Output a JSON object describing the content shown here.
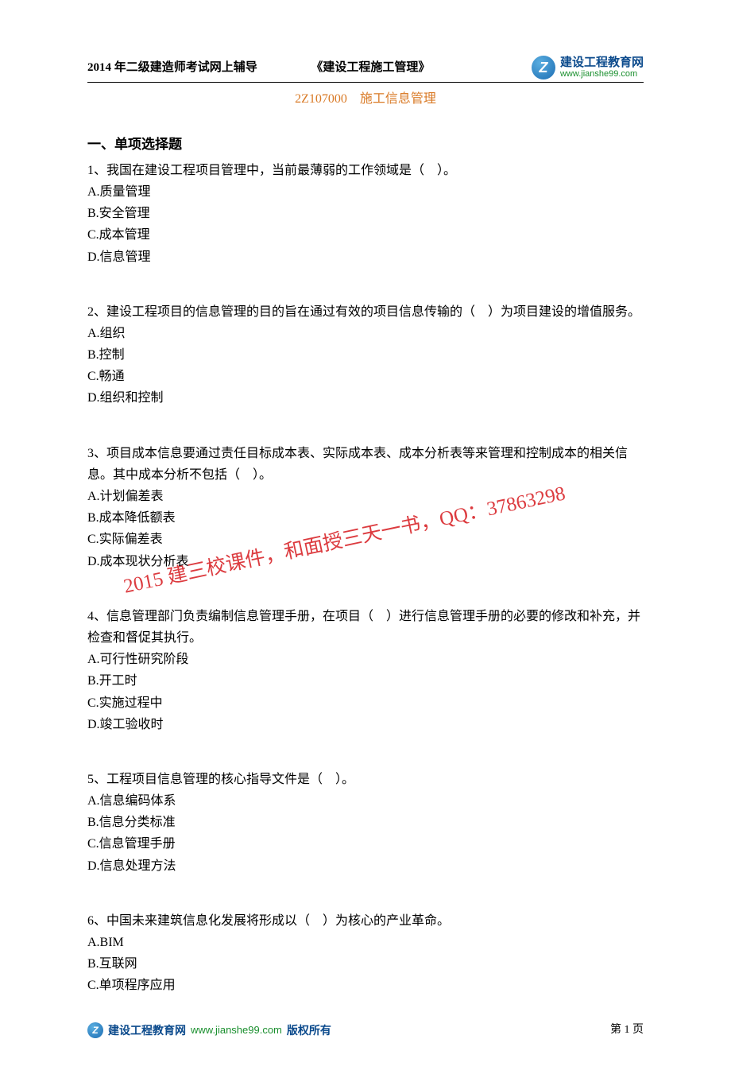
{
  "header": {
    "left": "2014 年二级建造师考试网上辅导",
    "center": "《建设工程施工管理》",
    "logo_letter": "Z",
    "logo_cn": "建设工程教育网",
    "logo_en": "www.jianshe99.com"
  },
  "subtitle": "2Z107000　施工信息管理",
  "section_title": "一、单项选择题",
  "questions": [
    {
      "text": "1、我国在建设工程项目管理中，当前最薄弱的工作领域是（　）。",
      "options": [
        "A.质量管理",
        "B.安全管理",
        "C.成本管理",
        "D.信息管理"
      ]
    },
    {
      "text": "2、建设工程项目的信息管理的目的旨在通过有效的项目信息传输的（　）为项目建设的增值服务。",
      "options": [
        "A.组织",
        "B.控制",
        "C.畅通",
        "D.组织和控制"
      ]
    },
    {
      "text": "3、项目成本信息要通过责任目标成本表、实际成本表、成本分析表等来管理和控制成本的相关信息。其中成本分析不包括（　）。",
      "options": [
        "A.计划偏差表",
        "B.成本降低额表",
        "C.实际偏差表",
        "D.成本现状分析表"
      ]
    },
    {
      "text": "4、信息管理部门负责编制信息管理手册，在项目（　）进行信息管理手册的必要的修改和补充，并检查和督促其执行。",
      "options": [
        "A.可行性研究阶段",
        "B.开工时",
        "C.实施过程中",
        "D.竣工验收时"
      ]
    },
    {
      "text": "5、工程项目信息管理的核心指导文件是（　）。",
      "options": [
        "A.信息编码体系",
        "B.信息分类标准",
        "C.信息管理手册",
        "D.信息处理方法"
      ]
    },
    {
      "text": "6、中国未来建筑信息化发展将形成以（　）为核心的产业革命。",
      "options": [
        "A.BIM",
        "B.互联网",
        "C.单项程序应用"
      ]
    }
  ],
  "watermark": "2015 建三校课件，和面授三天一书，QQ：37863298",
  "footer": {
    "logo_letter": "Z",
    "site_cn": "建设工程教育网",
    "site_url": "www.jianshe99.com",
    "copy": "版权所有",
    "page": "第 1 页"
  }
}
